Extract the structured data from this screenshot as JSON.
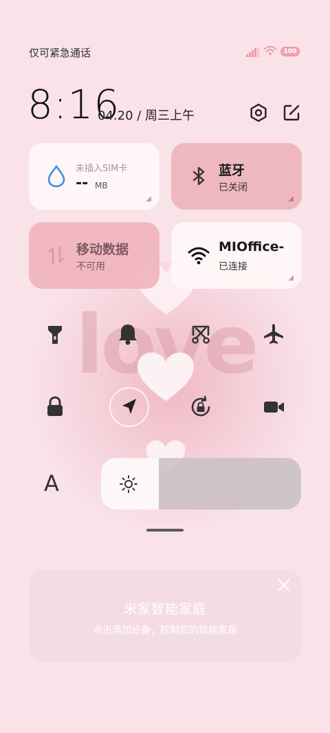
{
  "status_bar": {
    "carrier": "仅可紧急通话",
    "battery": "100"
  },
  "clock": {
    "time": "8:16",
    "date": "04.20 / 周三上午"
  },
  "tiles": {
    "sim": {
      "label": "未插入SIM卡",
      "value": "--",
      "unit": "MB"
    },
    "bluetooth": {
      "title": "蓝牙",
      "status": "已关闭"
    },
    "mobile_data": {
      "title": "移动数据",
      "status": "不可用"
    },
    "wifi": {
      "title": "MIOffice-",
      "status": "已连接"
    }
  },
  "background": {
    "text": "love"
  },
  "quick_toggles": [
    {
      "icon": "flashlight-icon"
    },
    {
      "icon": "bell-icon"
    },
    {
      "icon": "screenshot-icon"
    },
    {
      "icon": "airplane-icon"
    },
    {
      "icon": "lock-icon"
    },
    {
      "icon": "location-icon"
    },
    {
      "icon": "auto-rotate-icon"
    },
    {
      "icon": "video-camera-icon"
    }
  ],
  "brightness": {
    "level": 0.29,
    "font_label": "A"
  },
  "smart_home": {
    "title": "米家智能家庭",
    "subtitle": "点击添加设备，控制您的智能家居"
  },
  "colors": {
    "background": "#f9e2e8",
    "tile_accent": "#efb8c0",
    "wifi_blue": "#3a8ee6"
  }
}
